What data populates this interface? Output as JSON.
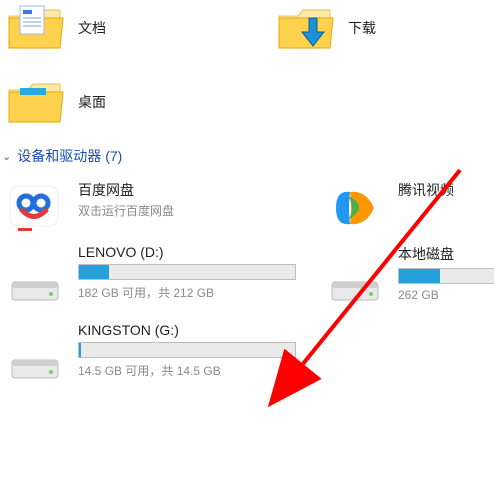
{
  "folders": {
    "documents": "文档",
    "downloads": "下载",
    "desktop": "桌面"
  },
  "section": {
    "title": "设备和驱动器",
    "count": "(7)"
  },
  "devices": {
    "baidu": {
      "title": "百度网盘",
      "sub": "双击运行百度网盘"
    },
    "tencent": {
      "title": "腾讯视频"
    },
    "lenovo": {
      "title": "LENOVO (D:)",
      "status": "182 GB 可用，共 212 GB",
      "fill_pct": 14
    },
    "localdisk": {
      "title": "本地磁盘",
      "status": "262 GB",
      "fill_pct": 30
    },
    "kingston": {
      "title": "KINGSTON (G:)",
      "status": "14.5 GB 可用，共 14.5 GB",
      "fill_pct": 1
    }
  }
}
